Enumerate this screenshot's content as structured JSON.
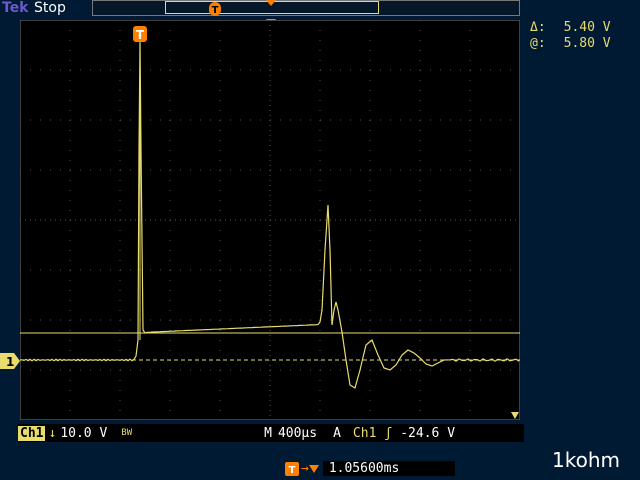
{
  "header": {
    "brand": "Tek",
    "status": "Stop"
  },
  "readouts": {
    "delta_symbol": "Δ:",
    "delta_value": "5.40 V",
    "at_symbol": "@:",
    "at_value": "5.80 V"
  },
  "channel": {
    "label": "Ch1",
    "coupling_icon": "down-arrow-icon",
    "scale": "10.0 V",
    "bw_label": "BW",
    "marker": "1"
  },
  "timebase": {
    "mode": "M",
    "value": "400µs"
  },
  "trigger": {
    "mode": "A",
    "source": "Ch1",
    "slope_icon": "rising-edge-icon",
    "level": "-24.6 V",
    "position": "1.05600ms",
    "marker": "T"
  },
  "footer": {
    "label": "1kohm"
  },
  "colors": {
    "trace": "#e8dc6e",
    "grid": "#555555",
    "trigger": "#ff7f00",
    "background": "#001a33"
  }
}
